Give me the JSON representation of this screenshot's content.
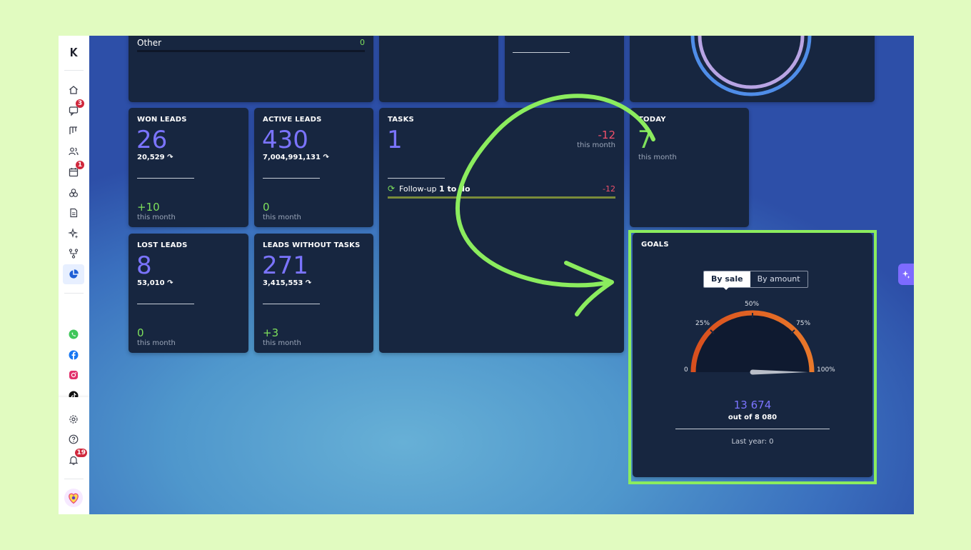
{
  "colors": {
    "accent": "#7b74ff",
    "positive": "#7ee05c",
    "negative": "#f0506a",
    "card": "#172640",
    "highlight": "#8bec5e",
    "badge": "#d0283d"
  },
  "sidebar": {
    "logo": "K",
    "items": [
      {
        "icon": "home-icon"
      },
      {
        "icon": "chat-icon",
        "badge": "3"
      },
      {
        "icon": "pipeline-icon"
      },
      {
        "icon": "contacts-icon"
      },
      {
        "icon": "calendar-icon",
        "badge": "1"
      },
      {
        "icon": "catalog-icon"
      },
      {
        "icon": "documents-icon"
      },
      {
        "icon": "ai-sparkle-icon"
      },
      {
        "icon": "automation-icon"
      },
      {
        "icon": "stats-icon",
        "active": true
      },
      {
        "icon": "whatsapp-icon"
      },
      {
        "icon": "facebook-icon"
      },
      {
        "icon": "instagram-icon"
      },
      {
        "icon": "tiktok-icon"
      },
      {
        "icon": "settings-icon"
      },
      {
        "icon": "help-icon"
      },
      {
        "icon": "notifications-icon",
        "badge": "19"
      },
      {
        "icon": "avatar-icon"
      }
    ]
  },
  "top_card": {
    "label": "Other",
    "value": "0"
  },
  "won_leads": {
    "title": "WON LEADS",
    "value": "26",
    "amount": "20,529",
    "delta": "+10",
    "period": "this month"
  },
  "active_leads": {
    "title": "ACTIVE LEADS",
    "value": "430",
    "amount": "7,004,991,131",
    "delta": "0",
    "period": "this month"
  },
  "lost_leads": {
    "title": "LOST LEADS",
    "value": "8",
    "amount": "53,010",
    "delta": "0",
    "period": "this month"
  },
  "leads_without_tasks": {
    "title": "LEADS WITHOUT TASKS",
    "value": "271",
    "amount": "3,415,553",
    "delta": "+3",
    "period": "this month"
  },
  "tasks": {
    "title": "TASKS",
    "value": "1",
    "delta": "-12",
    "period": "this month",
    "row_label": "Follow-up",
    "row_count": "1 to do",
    "row_delta": "-12"
  },
  "today": {
    "title": "TODAY",
    "value": "7",
    "period": "this month"
  },
  "goals": {
    "title": "GOALS",
    "tabs": [
      "By sale",
      "By amount"
    ],
    "selected_tab": "By sale",
    "gauge_labels": [
      "0",
      "25%",
      "50%",
      "75%",
      "100%"
    ],
    "gauge_value_fraction": 1.0,
    "value": "13 674",
    "target": "out of 8 080",
    "last_year": "Last year: 0"
  }
}
